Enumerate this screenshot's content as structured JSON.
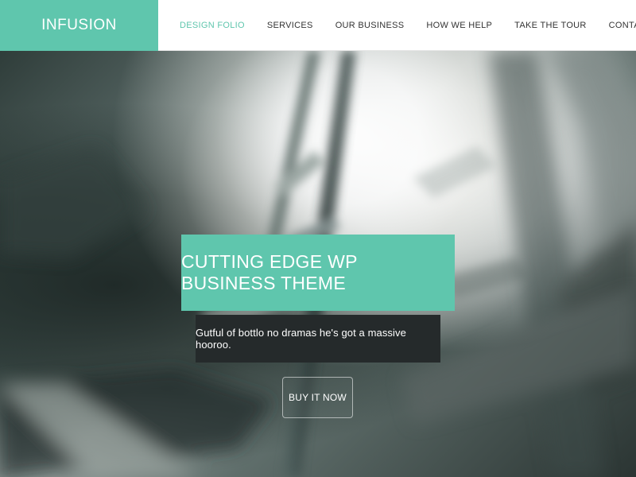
{
  "header": {
    "logo_text": "INFUSION",
    "nav": [
      {
        "label": "DESIGN FOLIO"
      },
      {
        "label": "SERVICES"
      },
      {
        "label": "OUR BUSINESS"
      },
      {
        "label": "HOW WE HELP"
      },
      {
        "label": "TAKE THE TOUR"
      },
      {
        "label": "CONTACT"
      }
    ]
  },
  "hero": {
    "title": "CUTTING EDGE WP BUSINESS THEME",
    "subtitle": "Gutful of bottlo no dramas he's got a massive hooroo.",
    "cta_label": "BUY IT NOW"
  },
  "colors": {
    "accent": "#5fc6ad",
    "header_bg": "#ffffff",
    "subtitle_bg": "#252a2b"
  }
}
